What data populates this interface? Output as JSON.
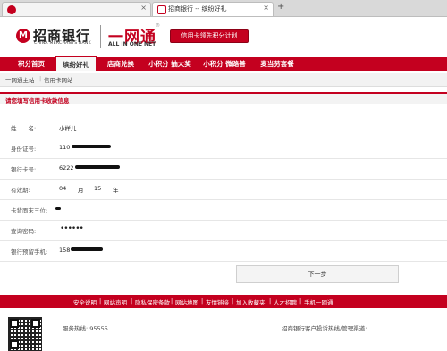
{
  "browser": {
    "tabs": [
      {
        "title": "",
        "icon": "bank-logo-icon"
      },
      {
        "title": "招商银行 -- 缤纷好礼",
        "icon": "page-icon"
      }
    ],
    "close_glyph": "×",
    "new_tab_glyph": "+"
  },
  "header": {
    "bank_name": "招商银行",
    "bank_name_en": "CHINA MERCHANTS BANK",
    "brand": "一网通",
    "brand_en": "ALL IN ONE NET",
    "registered_mark": "®",
    "promo_button": "信用卡领先积分计划",
    "logo_glyph": "M"
  },
  "nav": {
    "items": [
      {
        "label": "积分首页",
        "active": false
      },
      {
        "label": "缤纷好礼",
        "active": true
      },
      {
        "label": "店商兑换",
        "active": false
      },
      {
        "label": "小积分 抽大奖",
        "active": false
      },
      {
        "label": "小积分 微路善",
        "active": false
      },
      {
        "label": "麦当劳套餐",
        "active": false
      }
    ]
  },
  "breadcrumb": {
    "items": [
      "一网通主站",
      "信用卡网站"
    ],
    "separator": "|"
  },
  "form": {
    "title": "请您填写信用卡收款信息",
    "name_label": "姓　　名:",
    "name_value": "小样儿",
    "id_label": "身份证号:",
    "id_value": "110",
    "card_label": "银行卡号:",
    "card_value": "6222",
    "expiry_label": "有效期:",
    "expiry_month": "04",
    "expiry_month_unit": "月",
    "expiry_year": "15",
    "expiry_year_unit": "年",
    "cvv_label": "卡背面末三位:",
    "password_label": "查询密码:",
    "password_mask": "••••••",
    "phone_label": "银行预留手机:",
    "phone_value": "158",
    "next_button": "下一步"
  },
  "footer": {
    "links": [
      "安全说明",
      "网站声明",
      "隐私保密条款",
      "网站地图",
      "友情链接",
      "加入收藏夹",
      "人才招聘",
      "手机一网通"
    ],
    "separator": "|",
    "service_hotline": "服务热线: 95555",
    "complaint": "招商银行客户投诉热线/管理渠道:"
  },
  "colors": {
    "brand_red": "#c4001f",
    "nav_active_bg": "#f7f7f7"
  }
}
